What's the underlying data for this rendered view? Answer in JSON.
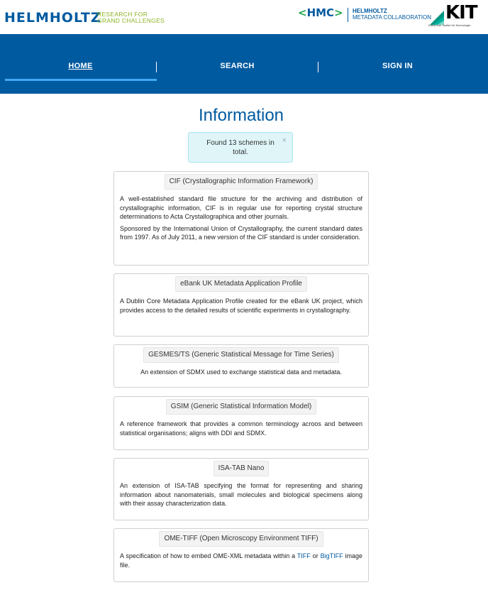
{
  "header": {
    "brand": "HELMHOLTZ",
    "tagline_1": "RESEARCH FOR",
    "tagline_2": "GRAND CHALLENGES",
    "hmc_logo": "HMC",
    "hmc_line1": "HELMHOLTZ",
    "hmc_line2": "METADATA COLLABORATION",
    "kit_logo": "KIT",
    "kit_sub": "Karlsruher Institut für Technologie"
  },
  "nav": {
    "home": "HOME",
    "search": "SEARCH",
    "sign_in": "SIGN IN"
  },
  "page_title": "Information",
  "alert": {
    "text": "Found 13 schemes in total.",
    "close": "×"
  },
  "schemes": [
    {
      "title": "CIF (Crystallographic Information Framework)",
      "para1": "A well-established standard file structure for the archiving and distribution of crystallographic information, CIF is in regular use for reporting crystal structure determinations to Acta Crystallographica and other journals.",
      "para2": "Sponsored by the International Union of Crystallography, the current standard dates from 1997. As of July 2011, a new version of the CIF standard is under consideration."
    },
    {
      "title": "eBank UK Metadata Application Profile",
      "para1": "A Dublin Core Metadata Application Profile created for the eBank UK project, which provides access to the detailed results of scientific experiments in crystallography."
    },
    {
      "title": "GESMES/TS (Generic Statistical Message for Time Series)",
      "para1": "An extension of SDMX used to exchange statistical data and metadata."
    },
    {
      "title": "GSIM (Generic Statistical Information Model)",
      "para1": "A reference framework that provides a common terminology acroos and between statistical organisations; aligns with DDI and SDMX."
    },
    {
      "title": "ISA-TAB Nano",
      "para1": "An extension of ISA-TAB specifying the format for representing and sharing information about nanomaterials, small molecules and biological specimens along with their assay characterization data."
    },
    {
      "title": "OME-TIFF (Open Microscopy Environment TIFF)",
      "para1_pre": "A specification of how to embed OME-XML metadata within a",
      "link1": "TIFF",
      "or": "or",
      "link2": "BigTIFF",
      "para1_post": "image file."
    }
  ],
  "colors": {
    "brand_blue": "#005aa0",
    "accent_green": "#8cb423",
    "nav_underline": "#3fa9f5",
    "alert_bg": "#dff5f8"
  }
}
